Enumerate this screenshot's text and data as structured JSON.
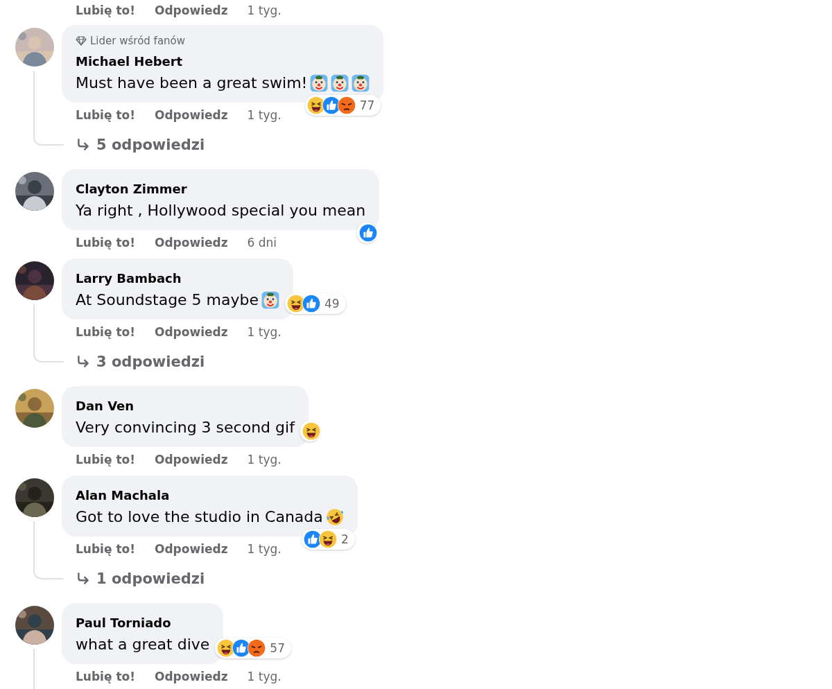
{
  "top_actions": {
    "like": "Lubię to!",
    "reply": "Odpowiedz",
    "time": "1 tyg."
  },
  "comments": [
    {
      "author": "Michael Hebert",
      "badge": "Lider wśród fanów",
      "text": "Must have been a great swim!",
      "emojis": [
        {
          "kind": "clown"
        },
        {
          "kind": "clown"
        },
        {
          "kind": "clown"
        }
      ],
      "reactions": {
        "kind": "corner",
        "icons": [
          {
            "kind": "haha"
          },
          {
            "kind": "like"
          },
          {
            "kind": "angry"
          }
        ],
        "count": "77"
      },
      "like": "Lubię to!",
      "reply": "Odpowiedz",
      "time": "1 tyg.",
      "replies": "5 odpowiedzi"
    },
    {
      "author": "Clayton Zimmer",
      "text": "Ya right , Hollywood special you mean",
      "reactions": {
        "kind": "corner",
        "icons": [
          {
            "kind": "like"
          }
        ]
      },
      "like": "Lubię to!",
      "reply": "Odpowiedz",
      "time": "6 dni"
    },
    {
      "author": "Larry Bambach",
      "text": "At Soundstage 5 maybe",
      "emojis": [
        {
          "kind": "clown"
        }
      ],
      "reactions": {
        "kind": "side",
        "icons": [
          {
            "kind": "haha"
          },
          {
            "kind": "like"
          }
        ],
        "count": "49"
      },
      "like": "Lubię to!",
      "reply": "Odpowiedz",
      "time": "1 tyg.",
      "replies": "3 odpowiedzi"
    },
    {
      "author": "Dan Ven",
      "text": "Very convincing 3 second gif",
      "reactions": {
        "kind": "side",
        "icons": [
          {
            "kind": "haha"
          }
        ]
      },
      "like": "Lubię to!",
      "reply": "Odpowiedz",
      "time": "1 tyg."
    },
    {
      "author": "Alan Machala",
      "text": "Got to love the studio in Canada",
      "emojis": [
        {
          "kind": "rofl"
        }
      ],
      "reactions": {
        "kind": "corner",
        "icons": [
          {
            "kind": "like"
          },
          {
            "kind": "haha"
          }
        ],
        "count": "2"
      },
      "like": "Lubię to!",
      "reply": "Odpowiedz",
      "time": "1 tyg.",
      "replies": "1 odpowiedzi"
    },
    {
      "author": "Paul Torniado",
      "text": "what a great dive",
      "reactions": {
        "kind": "side",
        "icons": [
          {
            "kind": "haha"
          },
          {
            "kind": "like"
          },
          {
            "kind": "angry"
          }
        ],
        "count": "57"
      },
      "like": "Lubię to!",
      "reply": "Odpowiedz",
      "time": "1 tyg.",
      "thread_continues": true
    }
  ]
}
